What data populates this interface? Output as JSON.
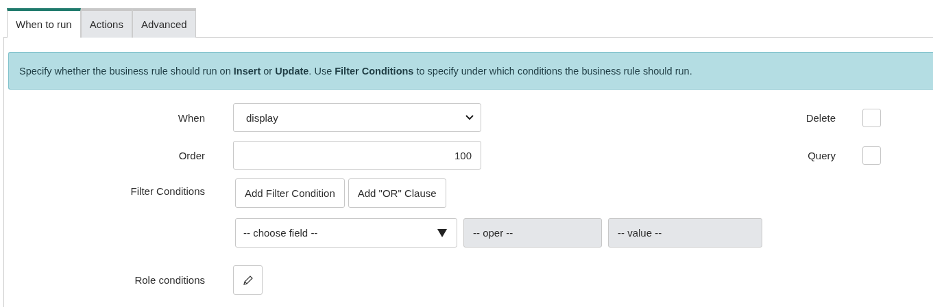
{
  "tabs": [
    {
      "label": "When to run",
      "selected": true
    },
    {
      "label": "Actions",
      "selected": false
    },
    {
      "label": "Advanced",
      "selected": false
    }
  ],
  "info": "Specify whether the business rule should run on **Insert** or **Update**. Use **Filter Conditions** to specify under which conditions the business rule should run.",
  "when": {
    "label": "When",
    "value": "display"
  },
  "order": {
    "label": "Order",
    "value": "100"
  },
  "checkboxes": [
    {
      "label": "Delete",
      "checked": false
    },
    {
      "label": "Query",
      "checked": false
    }
  ],
  "filter": {
    "label": "Filter Conditions",
    "buttons": [
      "Add Filter Condition",
      "Add \"OR\" Clause"
    ],
    "field": "-- choose field --",
    "oper": "-- oper --",
    "value": "-- value --"
  },
  "role": {
    "label": "Role conditions"
  }
}
